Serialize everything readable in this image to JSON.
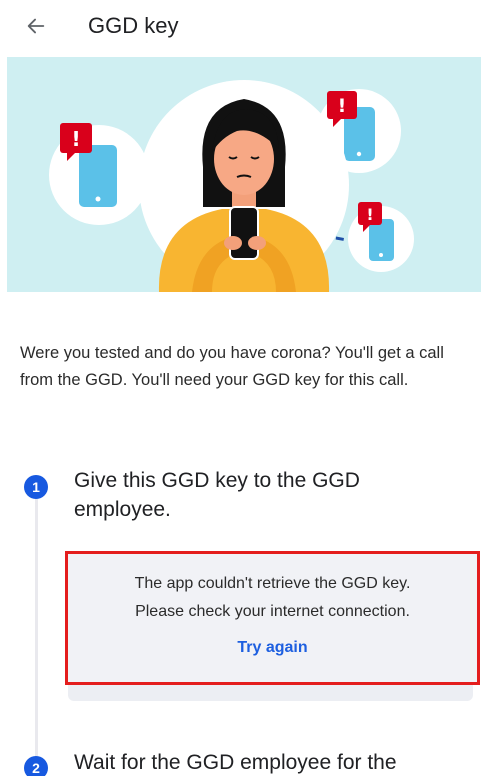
{
  "header": {
    "title": "GGD key",
    "back_icon": "arrow-left-icon"
  },
  "hero": {
    "illustration": "person-with-phone-notifications-illustration",
    "colors": {
      "background": "#cfeff2",
      "shirt": "#f8b531",
      "phone": "#5bc1e8",
      "alert": "#d9001b"
    }
  },
  "intro": {
    "text": "Were you tested and do you have corona? You'll get a call from the GGD. You'll need your GGD key for this call."
  },
  "steps": [
    {
      "number": "1",
      "title": "Give this GGD key to the GGD employee."
    },
    {
      "number": "2",
      "title": "Wait for the GGD employee for the"
    }
  ],
  "error_card": {
    "line1": "The app couldn't retrieve the GGD key.",
    "line2": "Please check your internet connection.",
    "retry_label": "Try again"
  },
  "colors": {
    "accent": "#1759e0",
    "link": "#1d5fe0",
    "highlight_border": "#e41d1d"
  }
}
